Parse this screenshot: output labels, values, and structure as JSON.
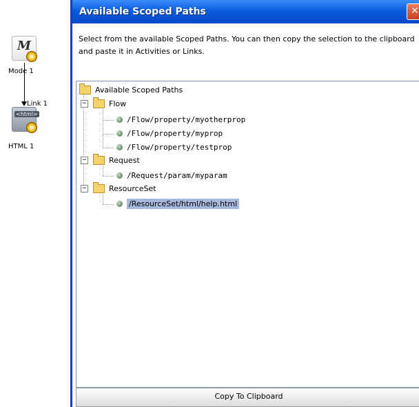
{
  "canvas": {
    "mode_node_label": "Mode 1",
    "html_node_label": "HTML 1",
    "link_label": "Link 1",
    "html_tag_text": "<html>",
    "mode_icon_letter": "M"
  },
  "dialog": {
    "title": "Available Scoped Paths",
    "close_glyph": "✕",
    "instructions": "Select from the available Scoped Paths.  You can then copy the selection to the clipboard and paste it in Activities or Links.",
    "copy_button_label": "Copy To Clipboard"
  },
  "tree": {
    "root": "Available Scoped Paths",
    "groups": [
      {
        "label": "Flow",
        "items": [
          "/Flow/property/myotherprop",
          "/Flow/property/myprop",
          "/Flow/property/testprop"
        ]
      },
      {
        "label": "Request",
        "items": [
          "/Request/param/myparam"
        ]
      },
      {
        "label": "ResourceSet",
        "items": [
          "/ResourceSet/html/help.html"
        ]
      }
    ],
    "selected_item": "/ResourceSet/html/help.html"
  },
  "colors": {
    "title_bar": "#0a5fe0",
    "selection": "#a6b8dc",
    "close_button": "#c9401f"
  }
}
